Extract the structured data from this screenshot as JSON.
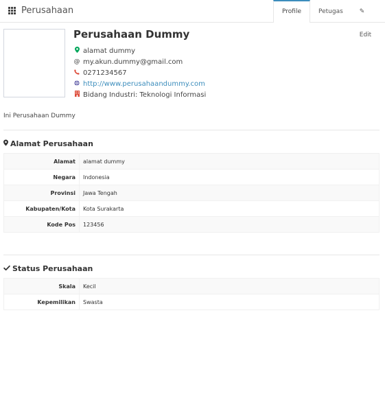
{
  "header": {
    "title": "Perusahaan",
    "tabs": [
      {
        "label": "Profile"
      },
      {
        "label": "Petugas"
      },
      {
        "label": "Edit"
      }
    ]
  },
  "profile": {
    "name": "Perusahaan Dummy",
    "address": "alamat dummy",
    "email": "my.akun.dummy@gmail.com",
    "phone": "0271234567",
    "website": "http://www.perusahaandummy.com",
    "industry": "Bidang Industri: Teknologi Informasi",
    "description": "Ini Perusahaan Dummy"
  },
  "address_section": {
    "title": "Alamat Perusahaan",
    "rows": [
      {
        "label": "Alamat",
        "value": "alamat dummy"
      },
      {
        "label": "Negara",
        "value": "Indonesia"
      },
      {
        "label": "Provinsi",
        "value": "Jawa Tengah"
      },
      {
        "label": "Kabupaten/Kota",
        "value": "Kota Surakarta"
      },
      {
        "label": "Kode Pos",
        "value": "123456"
      }
    ]
  },
  "status_section": {
    "title": "Status Perusahaan",
    "rows": [
      {
        "label": "Skala",
        "value": "Kecil"
      },
      {
        "label": "Kepemilikan",
        "value": "Swasta"
      }
    ]
  },
  "colors": {
    "accent": "#3c8dbc",
    "map_icon": "#00a65a",
    "phone_icon": "#dd4b39",
    "globe_icon": "#605ca8"
  },
  "icons": {
    "header": "grid-icon",
    "edit": "pencil-icon",
    "address": "map-marker-icon",
    "email": "at-icon",
    "phone": "phone-icon",
    "website": "globe-icon",
    "industry": "building-icon",
    "address_section": "map-marker-icon",
    "status_section": "check-icon"
  }
}
